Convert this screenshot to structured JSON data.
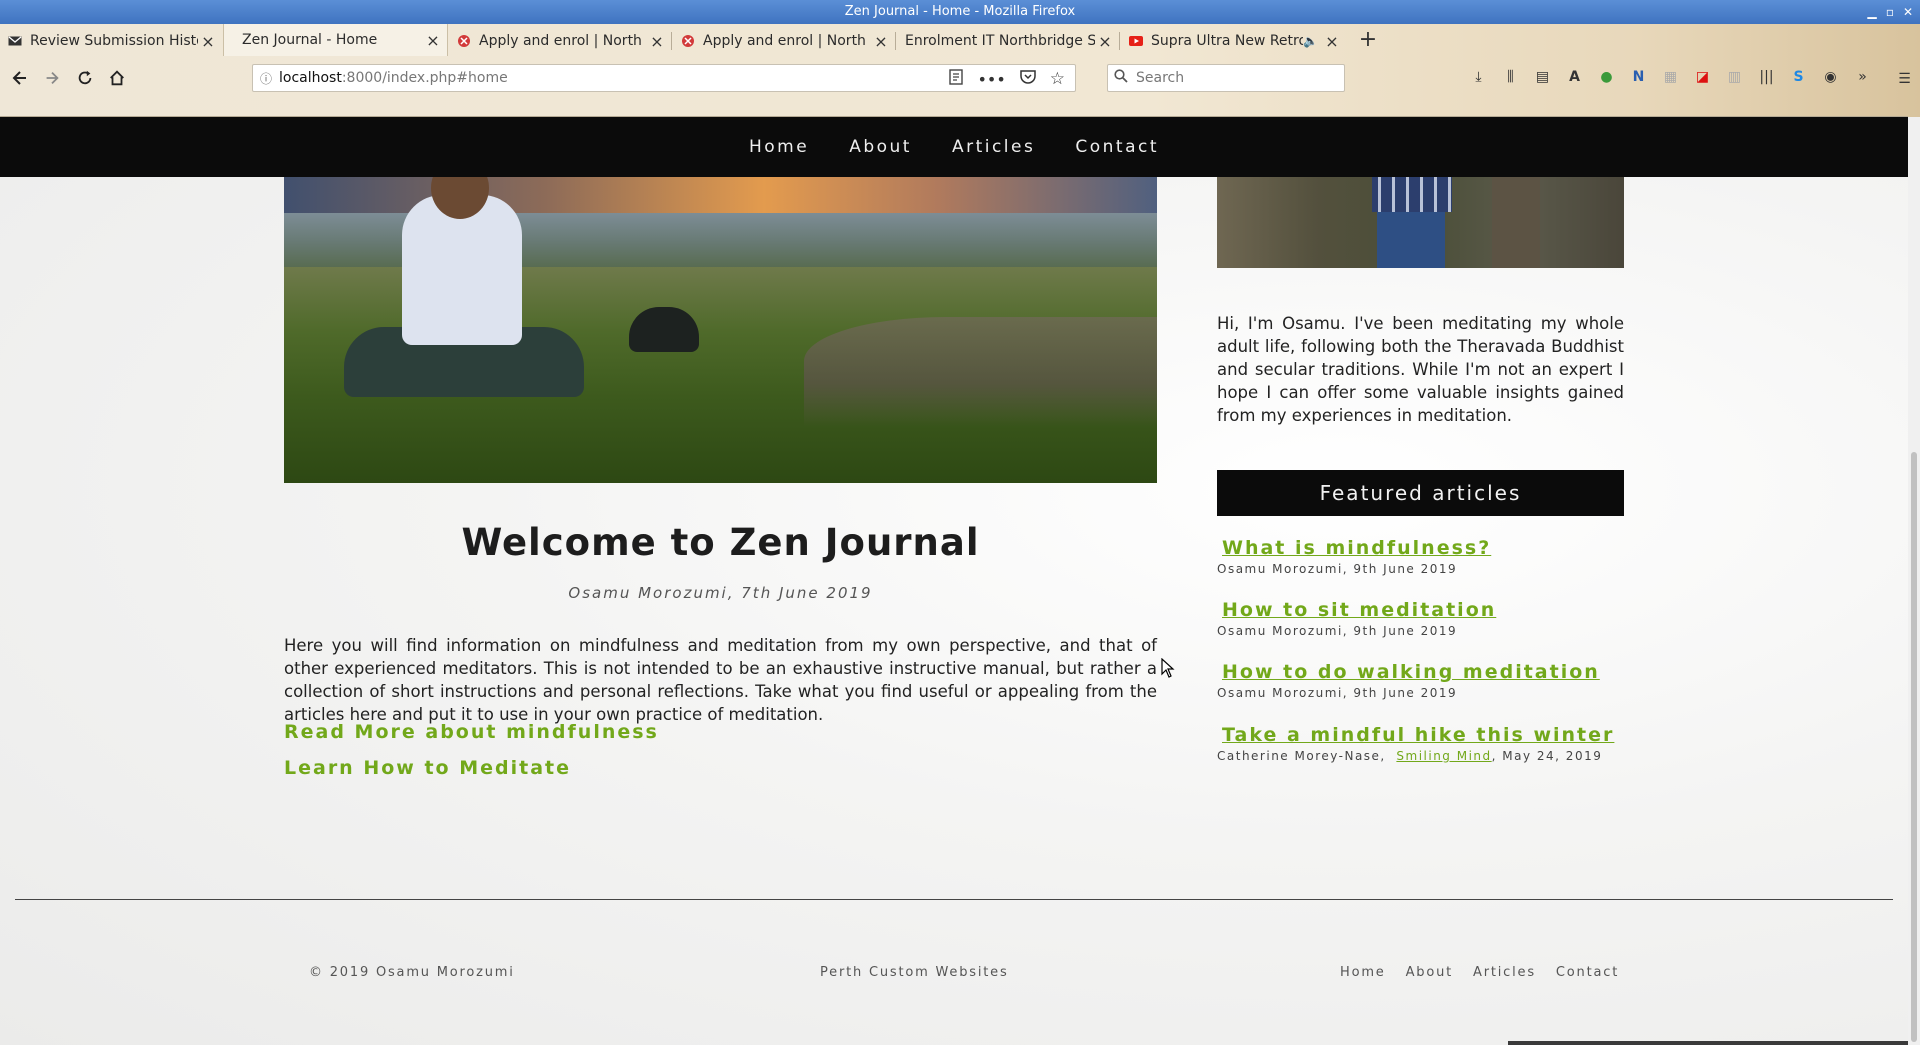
{
  "window": {
    "title": "Zen Journal - Home - Mozilla Firefox"
  },
  "tabs": [
    {
      "title": "Review Submission History",
      "icon": "envelope-icon",
      "active": false
    },
    {
      "title": "Zen Journal - Home",
      "icon": "none",
      "active": true
    },
    {
      "title": "Apply and enrol | North Metropolitan TAFE",
      "icon": "tafe-icon",
      "active": false
    },
    {
      "title": "Apply and enrol | North Metropolitan TAFE",
      "icon": "tafe-icon",
      "active": false
    },
    {
      "title": "Enrolment IT Northbridge Semester",
      "icon": "none",
      "active": false
    },
    {
      "title": "Supra Ultra New Retro",
      "icon": "youtube-icon",
      "active": false,
      "audio": true
    }
  ],
  "address_bar": {
    "host": "localhost",
    "rest": ":8000/index.php#home"
  },
  "search_bar": {
    "placeholder": "Search"
  },
  "site_nav": [
    {
      "label": "Home"
    },
    {
      "label": "About"
    },
    {
      "label": "Articles"
    },
    {
      "label": "Contact"
    }
  ],
  "post": {
    "title": "Welcome to Zen Journal",
    "meta": "Osamu Morozumi, 7th June 2019",
    "body": "Here you will find information on mindfulness and meditation from my own perspective, and that of other experienced meditators. This is not intended to be an exhaustive instructive manual, but rather a collection of short instructions and personal reflections. Take what you find useful or appealing from the articles here and put it to use in your own practice of meditation.",
    "links": [
      {
        "label": "Read More about mindfulness"
      },
      {
        "label": "Learn How to Meditate"
      }
    ]
  },
  "sidebar": {
    "bio": "Hi, I'm Osamu. I've been meditating my whole adult life, following both the Theravada Buddhist and secular traditions. While I'm not an expert I hope I can offer some valuable insights gained from my experiences in meditation.",
    "featured_heading": "Featured articles",
    "featured": [
      {
        "title": "What is mindfulness?",
        "meta": "Osamu Morozumi, 9th June 2019"
      },
      {
        "title": "How to sit meditation",
        "meta": "Osamu Morozumi, 9th June 2019"
      },
      {
        "title": "How to do walking meditation",
        "meta": "Osamu Morozumi, 9th June 2019"
      },
      {
        "title": "Take a mindful hike this winter",
        "meta_author": "Catherine Morey-Nase,",
        "meta_source": "Smiling Mind",
        "meta_date": ", May 24, 2019"
      }
    ]
  },
  "footer": {
    "copyright": "© 2019 Osamu Morozumi",
    "credit": "Perth Custom Websites",
    "nav": [
      {
        "label": "Home"
      },
      {
        "label": "About"
      },
      {
        "label": "Articles"
      },
      {
        "label": "Contact"
      }
    ]
  },
  "colors": {
    "accent_green": "#72a81a",
    "nav_black": "#0b0b0b"
  }
}
